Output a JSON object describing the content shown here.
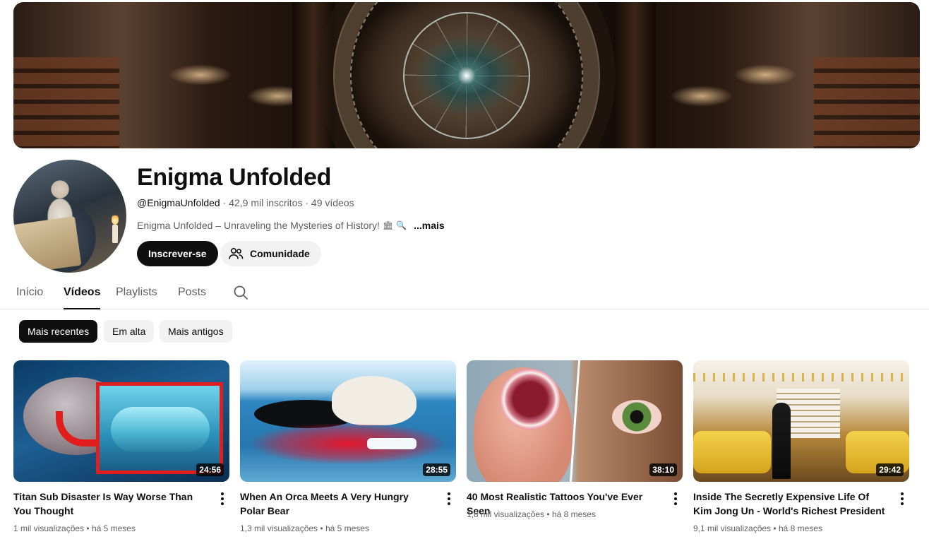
{
  "channel": {
    "name": "Enigma Unfolded",
    "handle": "@EnigmaUnfolded",
    "subscribers": "42,9 mil inscritos",
    "video_count": "49 vídeos",
    "separator": "·",
    "description": "Enigma Unfolded – Unraveling the Mysteries of History!",
    "description_emojis": [
      "🏛",
      "🔍"
    ],
    "more_label": "...mais"
  },
  "actions": {
    "subscribe_label": "Inscrever-se",
    "community_label": "Comunidade"
  },
  "tabs": [
    {
      "label": "Início",
      "active": false
    },
    {
      "label": "Vídeos",
      "active": true
    },
    {
      "label": "Playlists",
      "active": false
    },
    {
      "label": "Posts",
      "active": false
    }
  ],
  "chips": [
    {
      "label": "Mais recentes",
      "active": true
    },
    {
      "label": "Em alta",
      "active": false
    },
    {
      "label": "Mais antigos",
      "active": false
    }
  ],
  "videos": [
    {
      "title": "Titan Sub Disaster Is Way Worse Than You Thought",
      "duration": "24:56",
      "views": "1 mil visualizações",
      "age": "há 5 meses"
    },
    {
      "title": "When An Orca Meets A Very Hungry Polar Bear",
      "duration": "28:55",
      "views": "1,3 mil visualizações",
      "age": "há 5 meses"
    },
    {
      "title": "40 Most Realistic Tattoos You've Ever Seen",
      "duration": "38:10",
      "views": "1,8 mil visualizações",
      "age": "há 8 meses"
    },
    {
      "title": "Inside The Secretly Expensive Life Of Kim Jong Un - World's Richest President",
      "duration": "29:42",
      "views": "9,1 mil visualizações",
      "age": "há 8 meses"
    }
  ],
  "meta_separator": "•",
  "colors": {
    "text_primary": "#0f0f0f",
    "text_secondary": "#606060",
    "chip_bg": "#f2f2f2",
    "duration_bg": "#000000cc"
  }
}
